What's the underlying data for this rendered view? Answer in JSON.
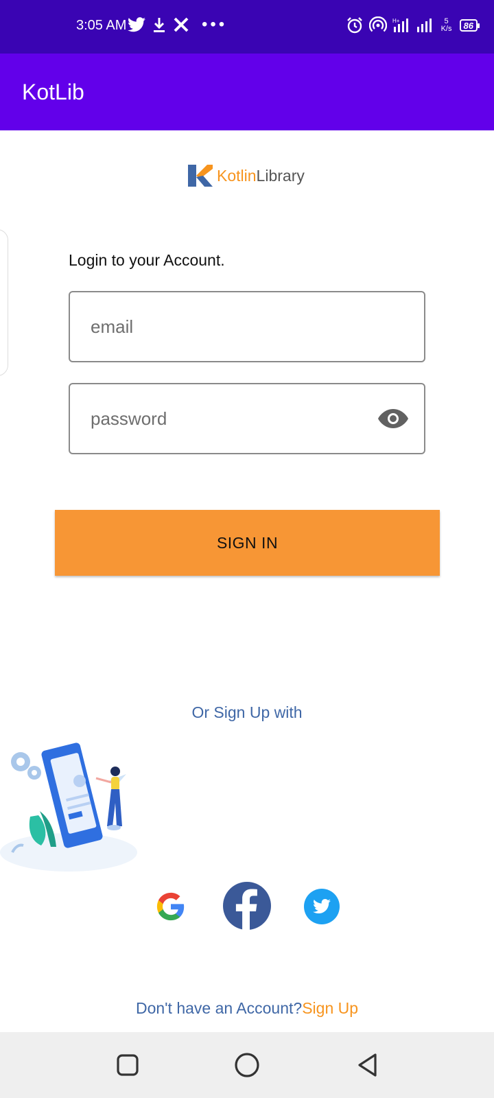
{
  "status_bar": {
    "time": "3:05 AM",
    "net_speed_value": "5",
    "net_speed_unit": "K/s",
    "battery": "86",
    "icons": [
      "twitter-icon",
      "download-icon",
      "x-icon",
      "more-dots-icon",
      "alarm-icon",
      "hotspot-icon",
      "signal-icon",
      "signal-icon",
      "battery-icon"
    ],
    "more_dots": "•••"
  },
  "app_bar": {
    "title": "KotLib"
  },
  "logo": {
    "part1": "Kotlin",
    "part2": "Library"
  },
  "login": {
    "heading": "Login to your Account.",
    "email_placeholder": "email",
    "email_value": "",
    "password_placeholder": "password",
    "password_value": "",
    "sign_in_label": "SIGN IN"
  },
  "social": {
    "heading": "Or Sign Up with",
    "providers": [
      "google",
      "facebook",
      "twitter"
    ]
  },
  "footer": {
    "prompt": "Don't have an Account?",
    "link": "Sign Up"
  },
  "colors": {
    "status_bar": "#3a04b3",
    "app_bar": "#6200ea",
    "accent_orange": "#f79635",
    "link_blue": "#3f67a6",
    "facebook": "#3b5998",
    "twitter": "#1da1f2"
  }
}
